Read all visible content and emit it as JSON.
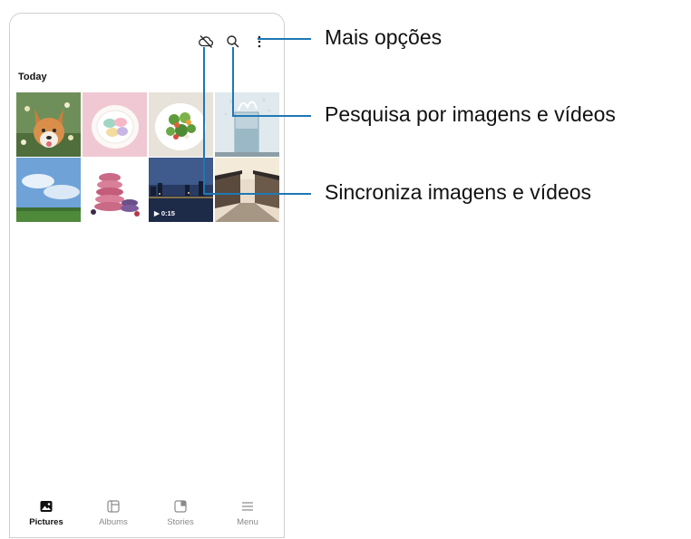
{
  "section": {
    "title": "Today"
  },
  "icons": {
    "sync": "cloud-off-icon",
    "search": "search-icon",
    "more": "more-vertical-icon"
  },
  "grid": {
    "items": [
      {
        "subject": "corgi-dog"
      },
      {
        "subject": "macarons-plate"
      },
      {
        "subject": "salad-bowl"
      },
      {
        "subject": "water-splash-glass"
      },
      {
        "subject": "blue-sky-field"
      },
      {
        "subject": "stacked-macarons"
      },
      {
        "subject": "city-night-river",
        "video": true,
        "duration": "▶ 0:15"
      },
      {
        "subject": "traditional-street"
      }
    ]
  },
  "nav": {
    "items": [
      {
        "label": "Pictures",
        "icon": "pictures-icon",
        "active": true
      },
      {
        "label": "Albums",
        "icon": "albums-icon",
        "active": false
      },
      {
        "label": "Stories",
        "icon": "stories-icon",
        "active": false
      },
      {
        "label": "Menu",
        "icon": "menu-icon",
        "active": false
      }
    ]
  },
  "callouts": {
    "more_options": "Mais opções",
    "search": "Pesquisa por imagens e vídeos",
    "sync": "Sincroniza imagens e vídeos"
  },
  "colors": {
    "callout_line": "#1f78b4",
    "active_text": "#111111",
    "inactive_text": "#8a8a8a"
  }
}
